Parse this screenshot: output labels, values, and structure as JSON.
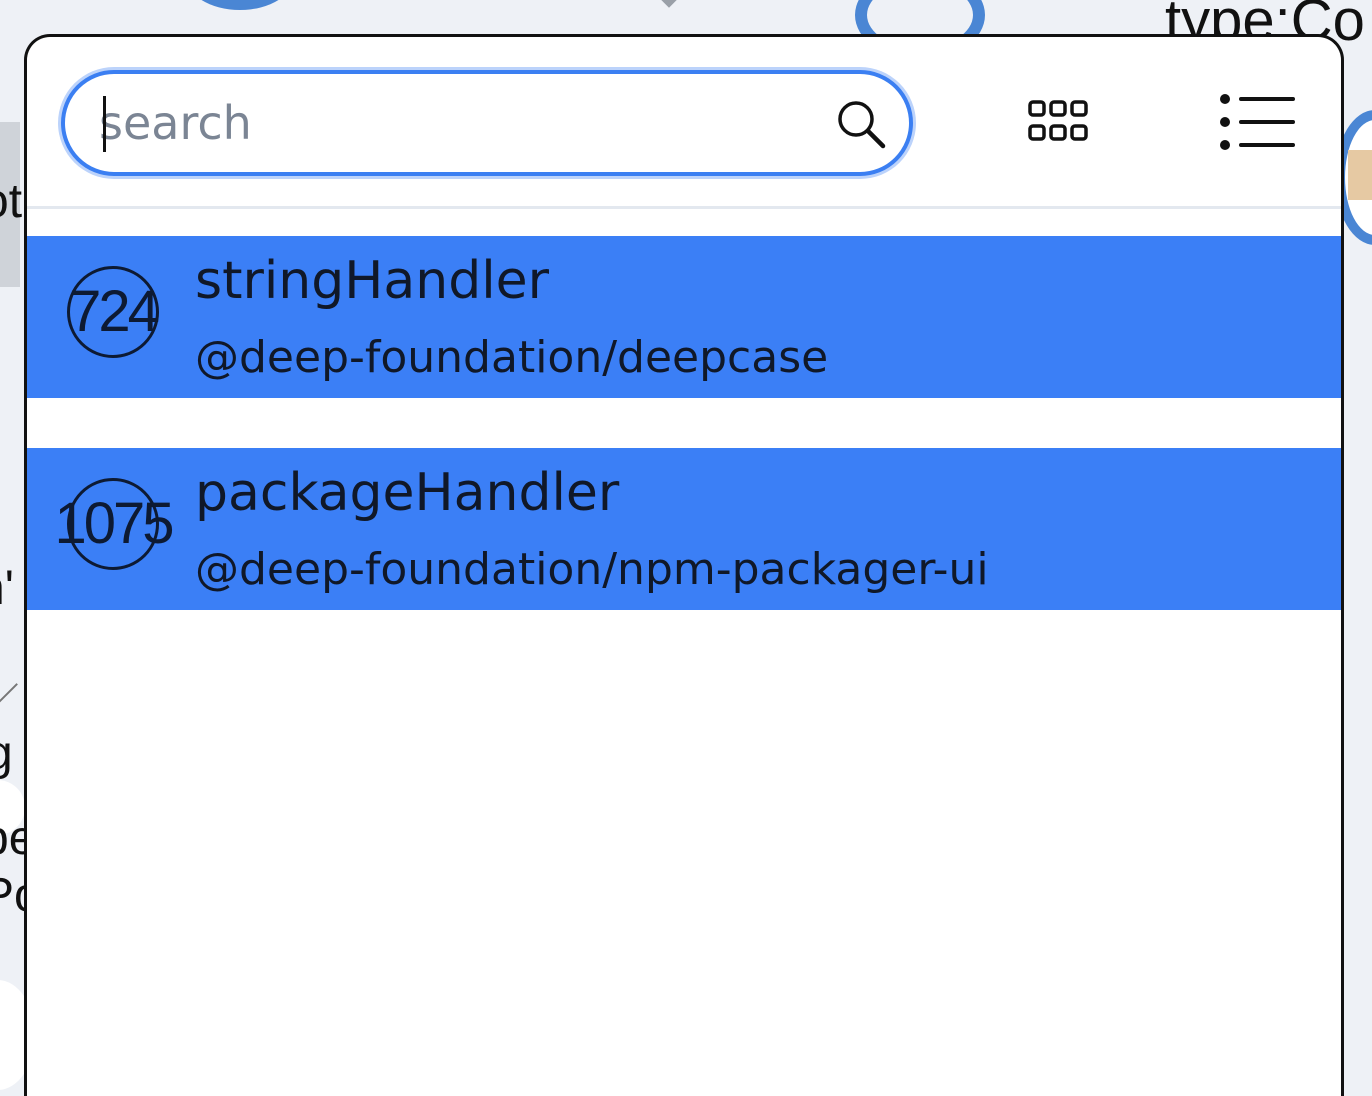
{
  "background": {
    "top_right_text": "type:Co",
    "left_fragments": [
      "ot",
      "n'",
      "g",
      "pe",
      "Po"
    ]
  },
  "search": {
    "placeholder": "search",
    "value": ""
  },
  "toolbar": {
    "grid_view_icon": "grid-icon",
    "list_view_icon": "list-icon",
    "search_icon": "search-icon"
  },
  "results": [
    {
      "id": "724",
      "name": "stringHandler",
      "package": "@deep-foundation/deepcase"
    },
    {
      "id": "1075",
      "name": "packageHandler",
      "package": "@deep-foundation/npm-packager-ui"
    }
  ],
  "colors": {
    "accent": "#3b7ff6",
    "focus_ring": "#3b7ff2",
    "text": "#101828"
  }
}
